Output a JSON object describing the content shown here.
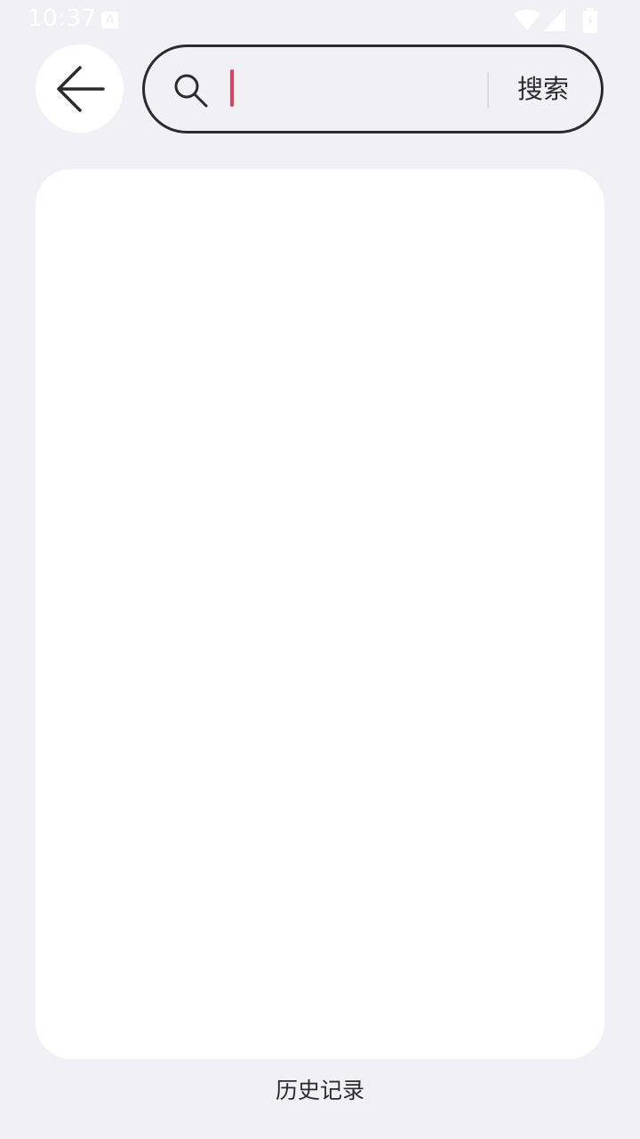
{
  "status_bar": {
    "time": "10:37",
    "notification_icon_letter": "A",
    "icons": [
      "wifi-icon",
      "cellular-signal-icon",
      "battery-icon"
    ]
  },
  "header": {
    "back_icon": "arrow-left-icon",
    "search": {
      "icon": "search-icon",
      "value": "",
      "placeholder": "",
      "button_label": "搜索"
    }
  },
  "content": {
    "items": []
  },
  "footer": {
    "label": "历史记录"
  },
  "colors": {
    "background": "#f0f0f5",
    "card": "#ffffff",
    "text": "#2b2b2f",
    "caret": "#e0405a",
    "border": "#2b2b2f"
  }
}
